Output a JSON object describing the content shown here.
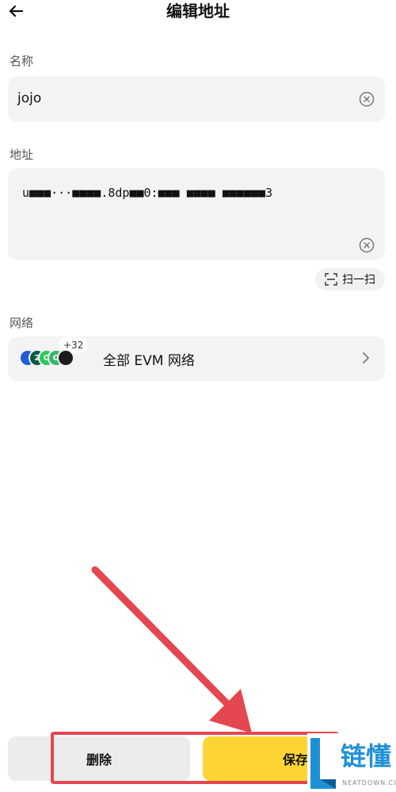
{
  "header": {
    "title": "编辑地址"
  },
  "form": {
    "name_label": "名称",
    "name_value": "jojo",
    "address_label": "地址",
    "address_value": "u■■■···■■■■.8dp■■0:■■■ ■■■■ ■■■■■■3",
    "scan_label": "扫一扫",
    "network_label": "网络",
    "network_value": "全部 EVM 网络",
    "network_more": "+32"
  },
  "chains": [
    {
      "name": "chain-1",
      "color": "#1f5cd9",
      "letter": ""
    },
    {
      "name": "chain-2",
      "color": "#0b5a3f",
      "letter": "2"
    },
    {
      "name": "chain-3",
      "color": "#2bc85a",
      "letter": "O"
    },
    {
      "name": "chain-4",
      "color": "#39b56a",
      "letter": "O"
    },
    {
      "name": "chain-5",
      "color": "#1c1c1c",
      "letter": ""
    }
  ],
  "buttons": {
    "delete_label": "删除",
    "save_label": "保存"
  },
  "watermark": {
    "text": "链懂",
    "sub": "NEATDOWN.COM"
  },
  "colors": {
    "accent": "#fcd535",
    "highlight": "#e4474f",
    "card": "#f3f3f3"
  }
}
